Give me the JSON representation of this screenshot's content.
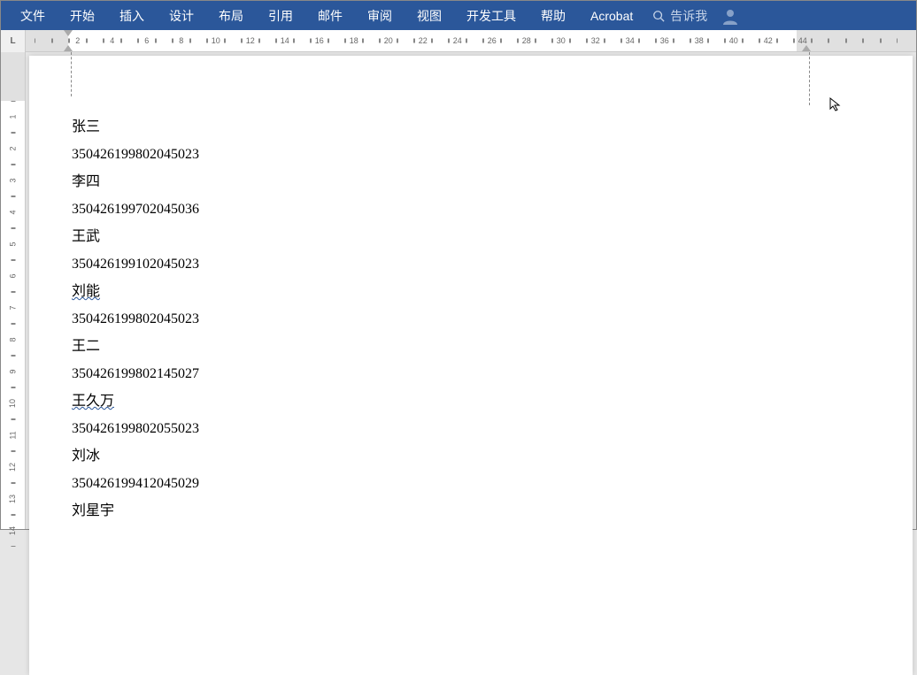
{
  "ribbon": {
    "tabs": [
      "文件",
      "开始",
      "插入",
      "设计",
      "布局",
      "引用",
      "邮件",
      "审阅",
      "视图",
      "开发工具",
      "帮助",
      "Acrobat"
    ],
    "search_placeholder": "告诉我"
  },
  "ruler_corner": "L",
  "h_ruler_numbers": [
    2,
    4,
    6,
    8,
    10,
    12,
    14,
    16,
    18,
    20,
    22,
    24,
    26,
    28,
    30,
    32,
    34,
    36,
    38,
    40,
    42,
    44
  ],
  "v_ruler_numbers": [
    1,
    2,
    3,
    4,
    5,
    6,
    7,
    8,
    9,
    10,
    11,
    12,
    13,
    14
  ],
  "document": {
    "lines": [
      {
        "text": "张三",
        "squiggle": false
      },
      {
        "text": "350426199802045023",
        "squiggle": false
      },
      {
        "text": "李四",
        "squiggle": false
      },
      {
        "text": "350426199702045036",
        "squiggle": false
      },
      {
        "text": "王武",
        "squiggle": false
      },
      {
        "text": "350426199102045023",
        "squiggle": false
      },
      {
        "text": "刘能",
        "squiggle": true
      },
      {
        "text": "350426199802045023",
        "squiggle": false
      },
      {
        "text": "王二",
        "squiggle": false
      },
      {
        "text": "350426199802145027",
        "squiggle": false
      },
      {
        "text": "王久万",
        "squiggle": true
      },
      {
        "text": "350426199802055023",
        "squiggle": false
      },
      {
        "text": "刘冰",
        "squiggle": false
      },
      {
        "text": "350426199412045029",
        "squiggle": false
      },
      {
        "text": "刘星宇",
        "squiggle": false
      }
    ]
  }
}
